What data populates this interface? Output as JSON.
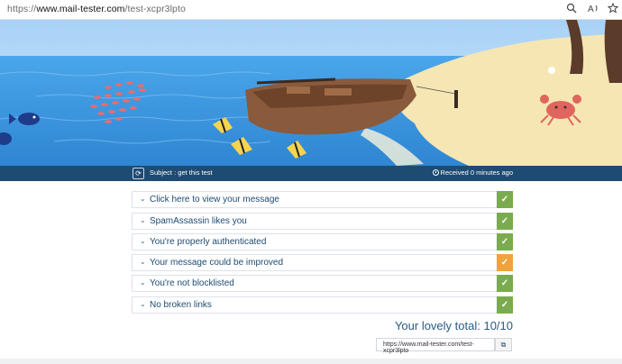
{
  "browser": {
    "url_scheme": "https://",
    "url_host": "www.mail-tester.com",
    "url_path": "/test-xcpr3lpto",
    "icons": [
      "zoom-icon",
      "read-aloud-icon",
      "favorite-star-icon"
    ]
  },
  "hero": {
    "alt_colors": {
      "sky": "#bcdcf6",
      "sea": "#3d9be3",
      "sand": "#f5e6b4",
      "boat": "#8a5a3c"
    }
  },
  "subjectbar": {
    "refresh_icon": "refresh-icon",
    "subject": "Subject : get this test",
    "received": "Received 0 minutes ago"
  },
  "results": [
    {
      "label": "Click here to view your message",
      "status": "ok",
      "mark": "✓"
    },
    {
      "label": "SpamAssassin likes you",
      "status": "ok",
      "mark": "✓"
    },
    {
      "label": "You're properly authenticated",
      "status": "ok",
      "mark": "✓"
    },
    {
      "label": "Your message could be improved",
      "status": "warn",
      "mark": "✓"
    },
    {
      "label": "You're not blocklisted",
      "status": "ok",
      "mark": "✓"
    },
    {
      "label": "No broken links",
      "status": "ok",
      "mark": "✓"
    }
  ],
  "total": "Your lovely total: 10/10",
  "share": {
    "url": "https://www.mail-tester.com/test-xcpr3lpto",
    "copy_icon": "copy-icon"
  },
  "colors": {
    "header": "#1e4b72",
    "ok": "#7bab4f",
    "warn": "#f0a33c"
  }
}
